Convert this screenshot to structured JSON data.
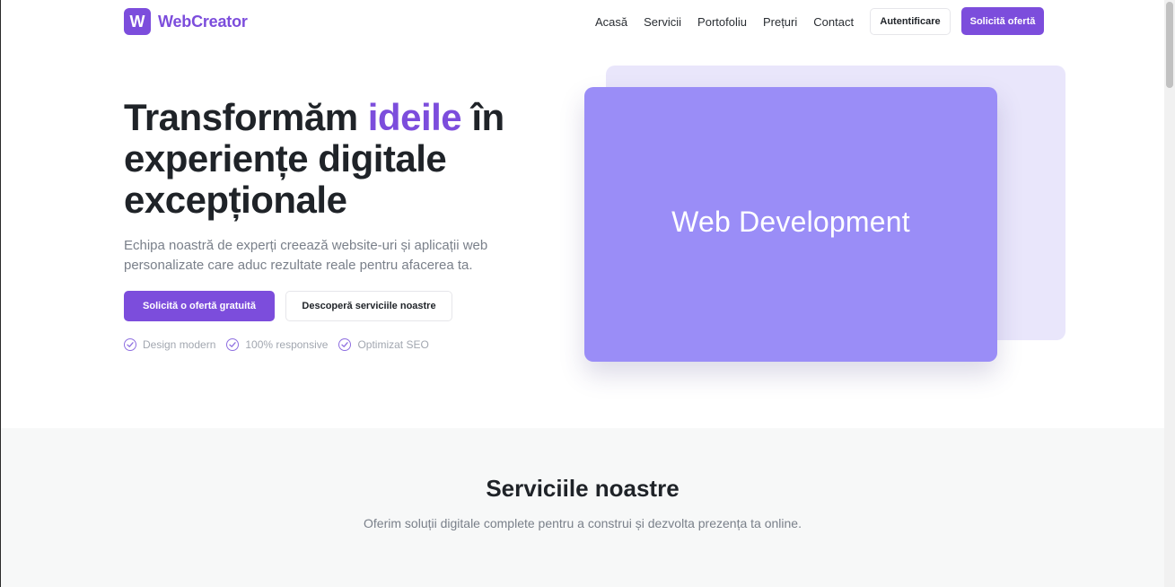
{
  "brand": {
    "logo_letter": "W",
    "name": "WebCreator",
    "accent_color": "#7c4ddc"
  },
  "nav": {
    "links": [
      "Acasă",
      "Servicii",
      "Portofoliu",
      "Prețuri",
      "Contact"
    ],
    "login_label": "Autentificare",
    "offer_label": "Solicită ofertă"
  },
  "hero": {
    "title_part1": "Transformăm ",
    "title_accent": "ideile",
    "title_part2": " în experiențe digitale excepționale",
    "description": "Echipa noastră de experți creează website-uri și aplicații web personalizate care aduc rezultate reale pentru afacerea ta.",
    "primary_button": "Solicită o ofertă gratuită",
    "secondary_button": "Descoperă serviciile noastre",
    "features": [
      "Design modern",
      "100% responsive",
      "Optimizat SEO"
    ],
    "card_label": "Web Development",
    "card_color": "#9a8df7",
    "card_back_color": "#e9e6fb"
  },
  "services": {
    "title": "Serviciile noastre",
    "description": "Oferim soluții digitale complete pentru a construi și dezvolta prezența ta online."
  }
}
